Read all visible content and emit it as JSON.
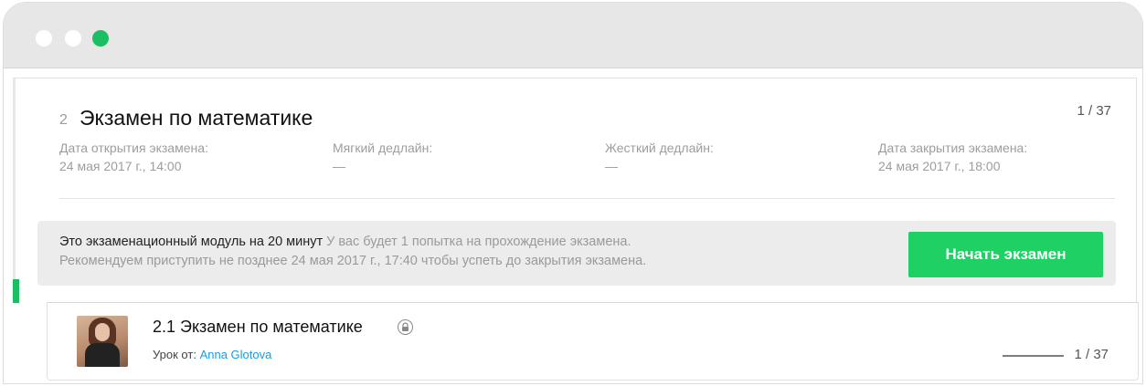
{
  "module": {
    "number": "2",
    "title": "Экзамен по математике",
    "count": "1 / 37",
    "meta": [
      {
        "label": "Дата открытия экзамена:",
        "value": "24 мая 2017 г., 14:00"
      },
      {
        "label": "Мягкий дедлайн:",
        "value": "—"
      },
      {
        "label": "Жесткий дедлайн:",
        "value": "—"
      },
      {
        "label": "Дата закрытия экзамена:",
        "value": "24 мая 2017 г., 18:00"
      }
    ]
  },
  "exam": {
    "intro": "Это экзаменационный модуль на 20 минут",
    "attempts": " У вас будет 1 попытка на прохождение экзамена.",
    "recommendation": "Рекомендуем приступить не позднее 24 мая 2017 г., 17:40 чтобы успеть до закрытия экзамена.",
    "start_button": "Начать экзамен"
  },
  "lesson": {
    "title": "2.1 Экзамен по математике",
    "author_prefix": "Урок от: ",
    "author_name": "Anna Glotova",
    "progress": "1 / 37"
  },
  "colors": {
    "accent": "#1bbf63",
    "button": "#1fd164",
    "link": "#1a9cde"
  },
  "icons": {
    "window_controls": [
      "close-dot",
      "minimize-dot",
      "maximize-dot"
    ],
    "lesson_status": "lock-icon"
  }
}
